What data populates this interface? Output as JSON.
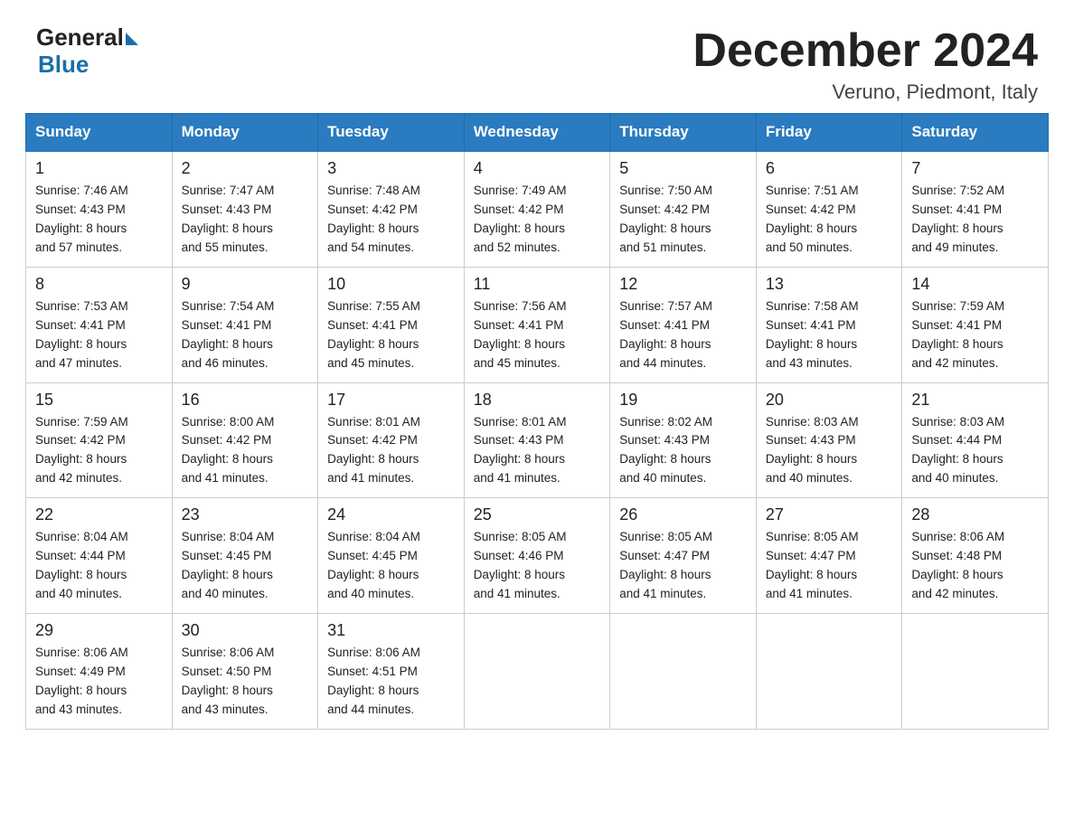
{
  "header": {
    "logo_general": "General",
    "logo_blue": "Blue",
    "title": "December 2024",
    "location": "Veruno, Piedmont, Italy"
  },
  "calendar": {
    "days_of_week": [
      "Sunday",
      "Monday",
      "Tuesday",
      "Wednesday",
      "Thursday",
      "Friday",
      "Saturday"
    ],
    "weeks": [
      [
        {
          "day": 1,
          "sunrise": "7:46 AM",
          "sunset": "4:43 PM",
          "daylight": "8 hours and 57 minutes."
        },
        {
          "day": 2,
          "sunrise": "7:47 AM",
          "sunset": "4:43 PM",
          "daylight": "8 hours and 55 minutes."
        },
        {
          "day": 3,
          "sunrise": "7:48 AM",
          "sunset": "4:42 PM",
          "daylight": "8 hours and 54 minutes."
        },
        {
          "day": 4,
          "sunrise": "7:49 AM",
          "sunset": "4:42 PM",
          "daylight": "8 hours and 52 minutes."
        },
        {
          "day": 5,
          "sunrise": "7:50 AM",
          "sunset": "4:42 PM",
          "daylight": "8 hours and 51 minutes."
        },
        {
          "day": 6,
          "sunrise": "7:51 AM",
          "sunset": "4:42 PM",
          "daylight": "8 hours and 50 minutes."
        },
        {
          "day": 7,
          "sunrise": "7:52 AM",
          "sunset": "4:41 PM",
          "daylight": "8 hours and 49 minutes."
        }
      ],
      [
        {
          "day": 8,
          "sunrise": "7:53 AM",
          "sunset": "4:41 PM",
          "daylight": "8 hours and 47 minutes."
        },
        {
          "day": 9,
          "sunrise": "7:54 AM",
          "sunset": "4:41 PM",
          "daylight": "8 hours and 46 minutes."
        },
        {
          "day": 10,
          "sunrise": "7:55 AM",
          "sunset": "4:41 PM",
          "daylight": "8 hours and 45 minutes."
        },
        {
          "day": 11,
          "sunrise": "7:56 AM",
          "sunset": "4:41 PM",
          "daylight": "8 hours and 45 minutes."
        },
        {
          "day": 12,
          "sunrise": "7:57 AM",
          "sunset": "4:41 PM",
          "daylight": "8 hours and 44 minutes."
        },
        {
          "day": 13,
          "sunrise": "7:58 AM",
          "sunset": "4:41 PM",
          "daylight": "8 hours and 43 minutes."
        },
        {
          "day": 14,
          "sunrise": "7:59 AM",
          "sunset": "4:41 PM",
          "daylight": "8 hours and 42 minutes."
        }
      ],
      [
        {
          "day": 15,
          "sunrise": "7:59 AM",
          "sunset": "4:42 PM",
          "daylight": "8 hours and 42 minutes."
        },
        {
          "day": 16,
          "sunrise": "8:00 AM",
          "sunset": "4:42 PM",
          "daylight": "8 hours and 41 minutes."
        },
        {
          "day": 17,
          "sunrise": "8:01 AM",
          "sunset": "4:42 PM",
          "daylight": "8 hours and 41 minutes."
        },
        {
          "day": 18,
          "sunrise": "8:01 AM",
          "sunset": "4:43 PM",
          "daylight": "8 hours and 41 minutes."
        },
        {
          "day": 19,
          "sunrise": "8:02 AM",
          "sunset": "4:43 PM",
          "daylight": "8 hours and 40 minutes."
        },
        {
          "day": 20,
          "sunrise": "8:03 AM",
          "sunset": "4:43 PM",
          "daylight": "8 hours and 40 minutes."
        },
        {
          "day": 21,
          "sunrise": "8:03 AM",
          "sunset": "4:44 PM",
          "daylight": "8 hours and 40 minutes."
        }
      ],
      [
        {
          "day": 22,
          "sunrise": "8:04 AM",
          "sunset": "4:44 PM",
          "daylight": "8 hours and 40 minutes."
        },
        {
          "day": 23,
          "sunrise": "8:04 AM",
          "sunset": "4:45 PM",
          "daylight": "8 hours and 40 minutes."
        },
        {
          "day": 24,
          "sunrise": "8:04 AM",
          "sunset": "4:45 PM",
          "daylight": "8 hours and 40 minutes."
        },
        {
          "day": 25,
          "sunrise": "8:05 AM",
          "sunset": "4:46 PM",
          "daylight": "8 hours and 41 minutes."
        },
        {
          "day": 26,
          "sunrise": "8:05 AM",
          "sunset": "4:47 PM",
          "daylight": "8 hours and 41 minutes."
        },
        {
          "day": 27,
          "sunrise": "8:05 AM",
          "sunset": "4:47 PM",
          "daylight": "8 hours and 41 minutes."
        },
        {
          "day": 28,
          "sunrise": "8:06 AM",
          "sunset": "4:48 PM",
          "daylight": "8 hours and 42 minutes."
        }
      ],
      [
        {
          "day": 29,
          "sunrise": "8:06 AM",
          "sunset": "4:49 PM",
          "daylight": "8 hours and 43 minutes."
        },
        {
          "day": 30,
          "sunrise": "8:06 AM",
          "sunset": "4:50 PM",
          "daylight": "8 hours and 43 minutes."
        },
        {
          "day": 31,
          "sunrise": "8:06 AM",
          "sunset": "4:51 PM",
          "daylight": "8 hours and 44 minutes."
        },
        null,
        null,
        null,
        null
      ]
    ],
    "labels": {
      "sunrise": "Sunrise:",
      "sunset": "Sunset:",
      "daylight": "Daylight:"
    }
  }
}
